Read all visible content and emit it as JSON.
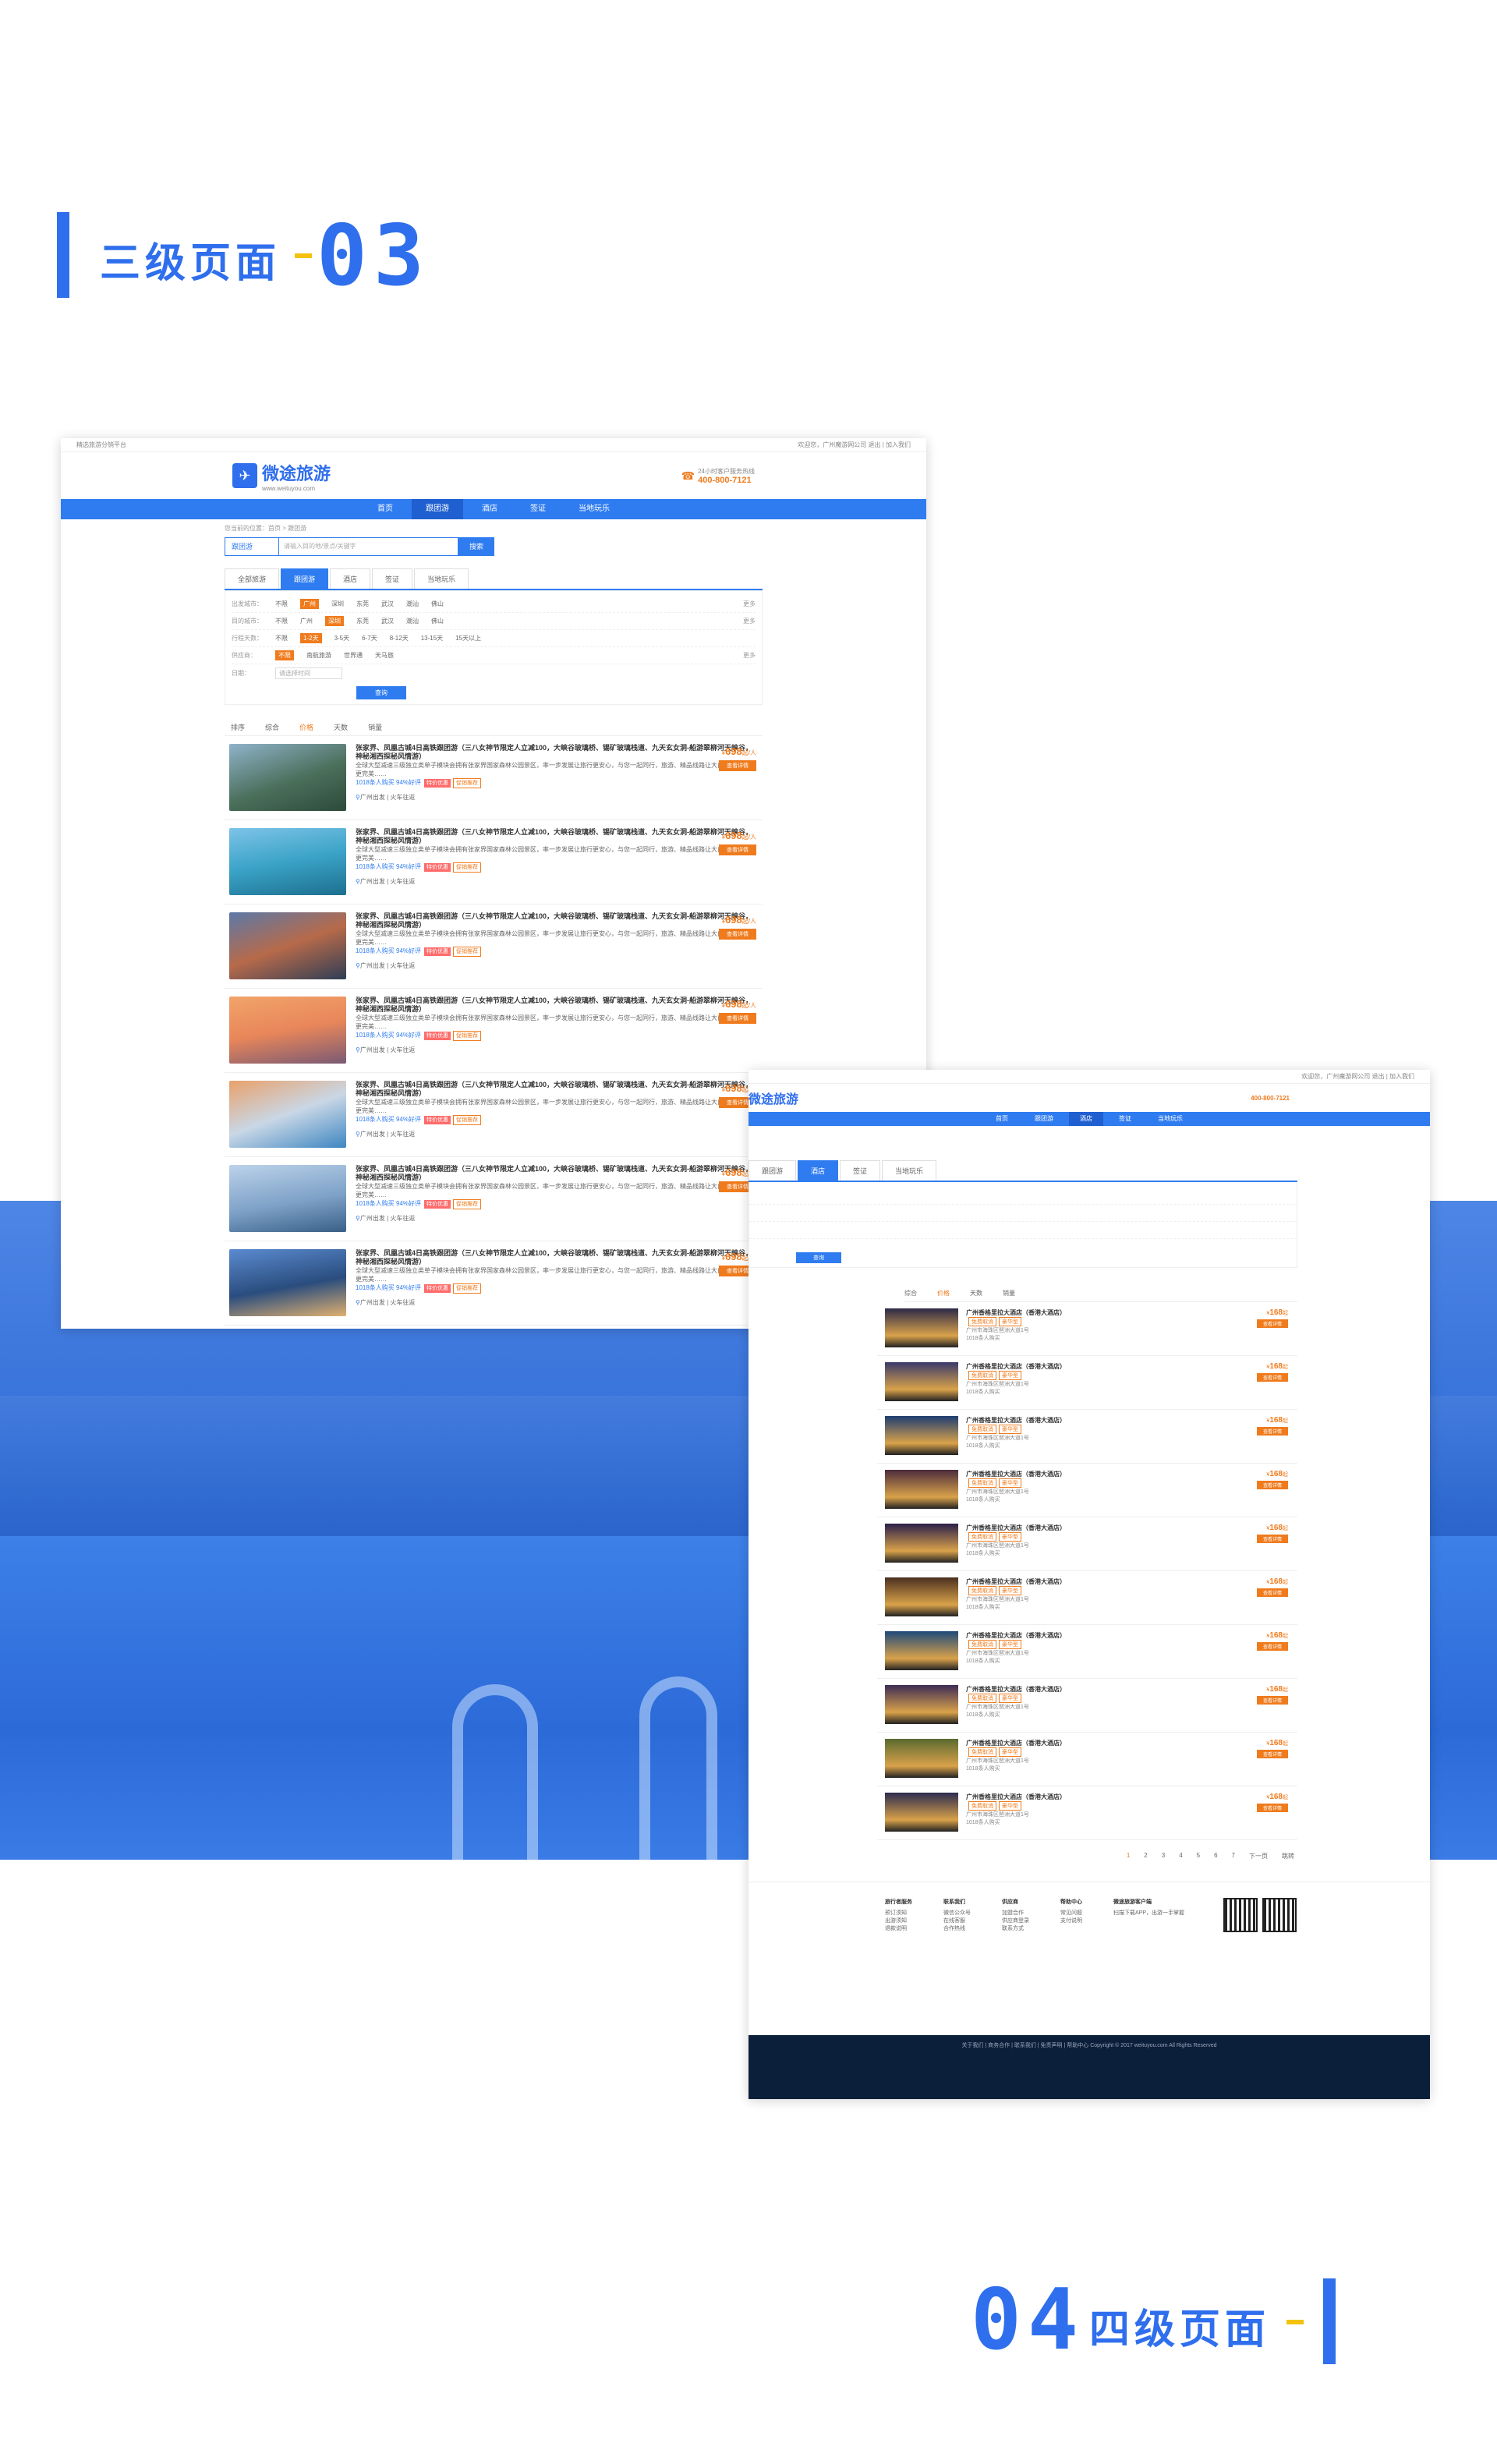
{
  "section1": {
    "title": "三级页面",
    "num": "03"
  },
  "section2": {
    "title": "四级页面",
    "num": "04"
  },
  "page3": {
    "topbar": {
      "left": "精选旅游分销平台",
      "right": "欢迎您，广州魔游网公司 退出 | 加入我们"
    },
    "logo": {
      "name": "微途旅游",
      "url": "www.weituyou.com"
    },
    "hotline": {
      "label": "24小时客户服务热线",
      "number": "400-800-7121"
    },
    "nav": [
      "首页",
      "跟团游",
      "酒店",
      "签证",
      "当地玩乐"
    ],
    "crumb": "您当前的位置：首页 > 跟团游",
    "search": {
      "select": "跟团游",
      "placeholder": "请输入目的地/景点/关键字",
      "button": "搜索"
    },
    "tabs": [
      "全部旅游",
      "跟团游",
      "酒店",
      "签证",
      "当地玩乐"
    ],
    "filters": [
      {
        "label": "出发城市：",
        "options": [
          "不限",
          "广州",
          "深圳",
          "东莞",
          "武汉",
          "潮汕",
          "佛山"
        ],
        "active": 1,
        "more": "更多"
      },
      {
        "label": "目的城市：",
        "options": [
          "不限",
          "广州",
          "深圳",
          "东莞",
          "武汉",
          "潮汕",
          "佛山"
        ],
        "active": 2,
        "more": "更多"
      },
      {
        "label": "行程天数：",
        "options": [
          "不限",
          "1-2天",
          "3-5天",
          "6-7天",
          "8-12天",
          "13-15天",
          "15天以上"
        ],
        "active": 1,
        "more": ""
      },
      {
        "label": "供应商：",
        "options": [
          "不限",
          "南航旅游",
          "世界通",
          "天马旅"
        ],
        "active": 0,
        "more": "更多"
      }
    ],
    "date": {
      "label": "日期：",
      "placeholder": "请选择时间",
      "button": "查询"
    },
    "sort": [
      "排序",
      "综合",
      "价格",
      "天数",
      "销量"
    ],
    "sort_active": 2,
    "item": {
      "title": "张家界、凤凰古城4日高铁跟团游（三八女神节限定人立减100，大峡谷玻璃桥、锡矿玻璃栈道、九天玄女洞-船游翠柳河天峡谷，神秘湘西探秘风情游）",
      "desc": "全球大型减速三级独立类单子模块会拥有张家界国家森林公园景区，率一步发展让旅行更安心，与您一起同行，旅游、精品线路让大自然旅行本身更完美……",
      "stats": "1018条人购买   94%好评",
      "tag": "特价优惠",
      "tag2": "促销推荐",
      "from": "广州出发",
      "type": "火车往返",
      "currency": "¥",
      "price": "698",
      "unit": "起/人",
      "button": "查看详情"
    },
    "item_count": 7
  },
  "page4": {
    "topbar": {
      "right": "欢迎您，广州魔游网公司 退出 | 加入我们"
    },
    "logo": {
      "name": "微途旅游"
    },
    "hotline": {
      "number": "400-800-7121"
    },
    "nav": [
      "首页",
      "跟团游",
      "酒店",
      "签证",
      "当地玩乐"
    ],
    "tabs": [
      "跟团游",
      "酒店",
      "签证",
      "当地玩乐"
    ],
    "filter_button": "查询",
    "sort": [
      "综合",
      "价格",
      "天数",
      "销量"
    ],
    "hotel": {
      "name": "广州香格里拉大酒店（香港大酒店）",
      "tags": [
        "免费取消",
        "豪华型"
      ],
      "addr": "广州市海珠区琶洲大道1号",
      "count": "1018条人购买",
      "currency": "¥",
      "price": "168",
      "unit": "起",
      "button": "查看详情"
    },
    "hotel_count": 10,
    "pager": [
      "1",
      "2",
      "3",
      "4",
      "5",
      "6",
      "7",
      "下一页",
      "跳转"
    ],
    "footer": [
      {
        "h": "旅行者服务",
        "items": [
          "预订须知",
          "出游须知",
          "退款说明"
        ]
      },
      {
        "h": "联系我们",
        "items": [
          "微信公众号",
          "在线客服",
          "合作热线"
        ]
      },
      {
        "h": "供应商",
        "items": [
          "加盟合作",
          "供应商登录",
          "联系方式"
        ]
      },
      {
        "h": "帮助中心",
        "items": [
          "常见问题",
          "支付说明"
        ]
      },
      {
        "h": "微途旅游客户端",
        "items": [
          "扫描下载APP，出游一手掌握"
        ]
      }
    ],
    "copyright": "关于我们 | 商务合作 | 联系我们 | 免责声明 | 帮助中心  Copyright © 2017 weituyou.com All Rights Reserved"
  }
}
